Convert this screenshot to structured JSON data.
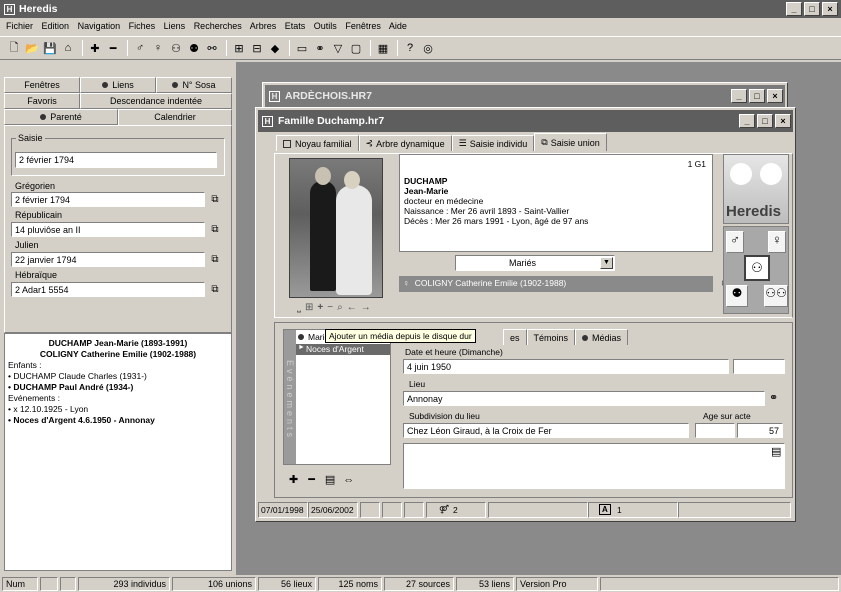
{
  "app": {
    "title": "Heredis"
  },
  "menu": [
    "Fichier",
    "Edition",
    "Navigation",
    "Fiches",
    "Liens",
    "Recherches",
    "Arbres",
    "Etats",
    "Outils",
    "Fenêtres",
    "Aide"
  ],
  "left_tabs": {
    "row1": [
      "Fenêtres",
      "Liens",
      "N° Sosa"
    ],
    "row2": [
      "Favoris",
      "Descendance indentée"
    ],
    "row3": [
      "Parenté",
      "Calendrier"
    ]
  },
  "calendar": {
    "saisie_label": "Saisie",
    "saisie_value": "2 février 1794",
    "gregorien_label": "Grégorien",
    "gregorien_value": "2 février 1794",
    "republicain_label": "Républicain",
    "republicain_value": "14 pluviôse an II",
    "julien_label": "Julien",
    "julien_value": "22 janvier 1794",
    "hebraique_label": "Hébraïque",
    "hebraique_value": "2 Adar1 5554"
  },
  "summary": {
    "line1": "DUCHAMP Jean-Marie (1893-1991)",
    "line2": "COLIGNY Catherine Emilie (1902-1988)",
    "enfants_label": "Enfants :",
    "child1": "• DUCHAMP Claude Charles (1931-)",
    "child2": "• DUCHAMP Paul André (1934-)",
    "events_label": "Evénements :",
    "event1": "• x 12.10.1925 - Lyon",
    "event2": "• Noces d'Argent 4.6.1950 - Annonay"
  },
  "back_window": {
    "title": "ARDÈCHOIS.HR7"
  },
  "family_window": {
    "title": "Famille Duchamp.hr7",
    "tabs": [
      "Noyau familial",
      "Arbre dynamique",
      "Saisie individu",
      "Saisie union"
    ],
    "generation": "1 G1",
    "person": {
      "surname": "DUCHAMP",
      "given": "Jean-Marie",
      "occupation": "docteur en médecine",
      "birth": "Naissance : Mer 26 avril 1893 - Saint-Vallier",
      "death": "Décès : Mer 26 mars 1991 - Lyon, âgé de 97 ans"
    },
    "status_select": "Mariés",
    "spouse": "COLIGNY Catherine Emilie (1902-1988)",
    "logo": "Heredis",
    "tooltip": "Ajouter un média depuis le disque dur",
    "event_list": [
      "Mariés",
      "Noces d'Argent"
    ],
    "event_vertical_label": "Evénements",
    "event_tabs": [
      "es",
      "Témoins",
      "Médias"
    ],
    "date_label": "Date et heure (Dimanche)",
    "date_value": "4 juin 1950",
    "lieu_label": "Lieu",
    "lieu_value": "Annonay",
    "subdivision_label": "Subdivision du lieu",
    "subdivision_value": "Chez Léon Giraud, à la Croix de Fer",
    "age_label": "Age sur acte",
    "age_value": "57",
    "status_created": "07/01/1998",
    "status_modified": "25/06/2002",
    "status_count": "2",
    "status_a": "1"
  },
  "statusbar": {
    "num": "Num",
    "individus": "293 individus",
    "unions": "106 unions",
    "lieux": "56 lieux",
    "noms": "125 noms",
    "sources": "27 sources",
    "liens": "53 liens",
    "version": "Version Pro"
  }
}
